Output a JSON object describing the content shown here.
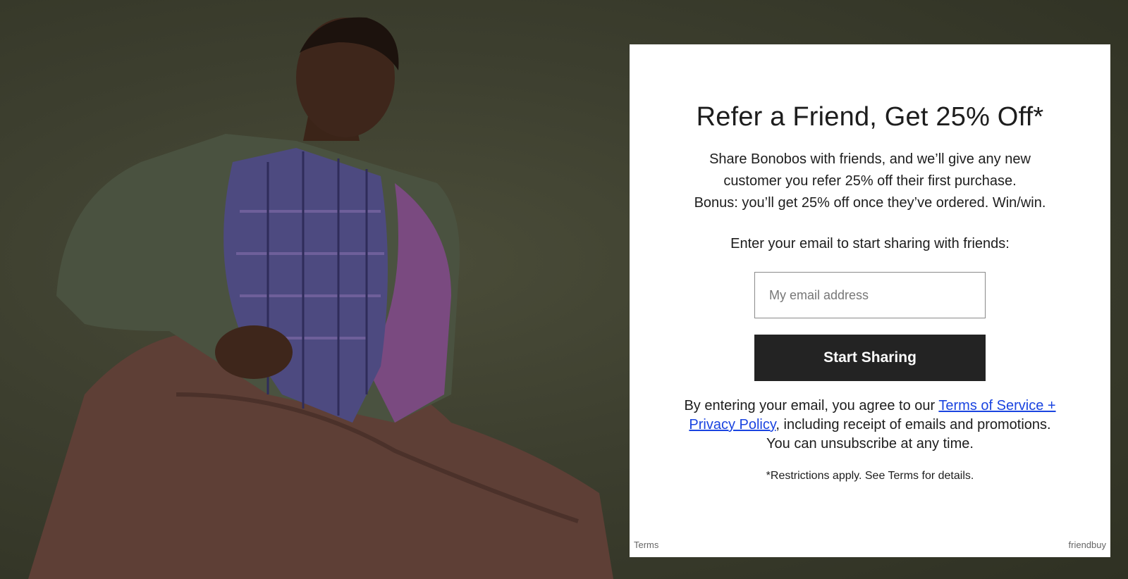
{
  "modal": {
    "title": "Refer a Friend, Get 25% Off*",
    "description_lines": [
      "Share Bonobos with friends, and we’ll give any new",
      "customer you refer 25% off their first purchase.",
      "Bonus: you’ll get 25% off once they’ve ordered. Win/win."
    ],
    "email_prompt": "Enter your email to start sharing with friends:",
    "email_input": {
      "value": "",
      "placeholder": "My email address"
    },
    "cta_label": "Start Sharing",
    "consent": {
      "before": "By entering your email, you agree to our ",
      "link": "Terms of Service + Privacy Policy",
      "after": ", including receipt of emails and promotions. You can unsubscribe at any time."
    },
    "restrictions": "*Restrictions apply. See Terms for details.",
    "footer": {
      "terms_link": "Terms",
      "brand": "friendbuy"
    }
  },
  "colors": {
    "background": "#3a3c2c",
    "cta_background": "#232323",
    "link": "#1a44e0"
  }
}
